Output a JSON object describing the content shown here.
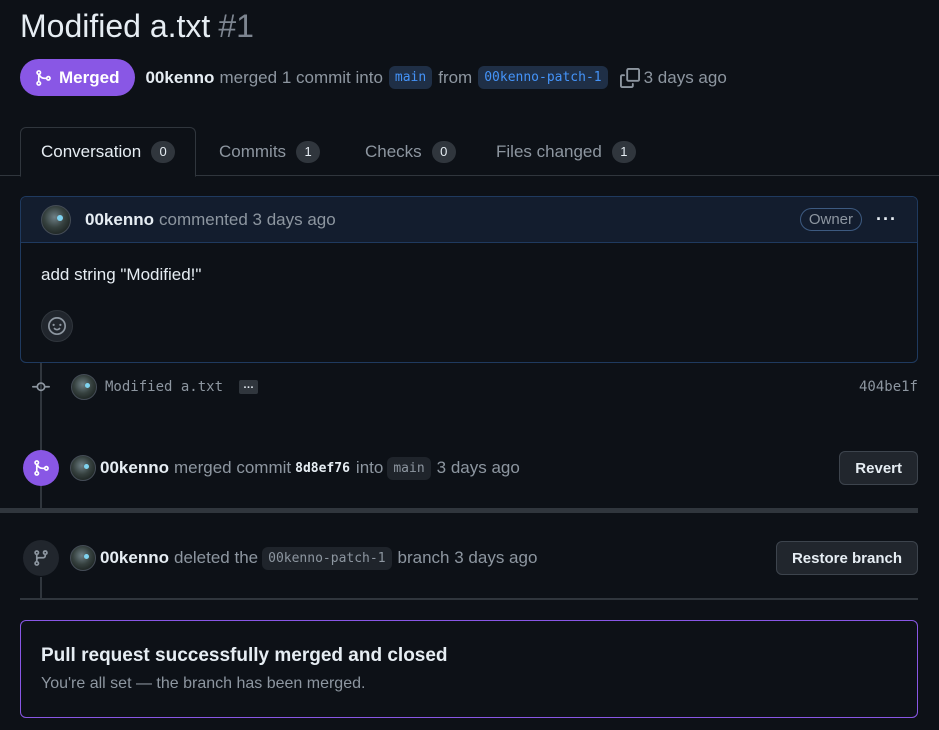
{
  "header": {
    "title": "Modified a.txt",
    "number": "#1",
    "status": "Merged",
    "author": "00kenno",
    "merge_text": "merged 1 commit into",
    "base_branch": "main",
    "from_text": "from",
    "head_branch": "00kenno-patch-1",
    "time": "3 days ago"
  },
  "tabs": [
    {
      "label": "Conversation",
      "count": "0"
    },
    {
      "label": "Commits",
      "count": "1"
    },
    {
      "label": "Checks",
      "count": "0"
    },
    {
      "label": "Files changed",
      "count": "1"
    }
  ],
  "comment": {
    "author": "00kenno",
    "action": "commented 3 days ago",
    "role": "Owner",
    "menu": "···",
    "body": "add string \"Modified!\""
  },
  "commit": {
    "message": "Modified a.txt",
    "more": "…",
    "sha": "404be1f"
  },
  "merge_event": {
    "author": "00kenno",
    "text": "merged commit",
    "sha": "8d8ef76",
    "into": "into",
    "branch": "main",
    "time": "3 days ago",
    "button": "Revert"
  },
  "delete_event": {
    "author": "00kenno",
    "text": "deleted the",
    "branch": "00kenno-patch-1",
    "suffix": "branch 3 days ago",
    "button": "Restore branch"
  },
  "final": {
    "heading": "Pull request successfully merged and closed",
    "subtext": "You're all set — the branch has been merged."
  },
  "colors": {
    "merged": "#8957e5",
    "link": "#4493f8",
    "background": "#0d1117"
  }
}
